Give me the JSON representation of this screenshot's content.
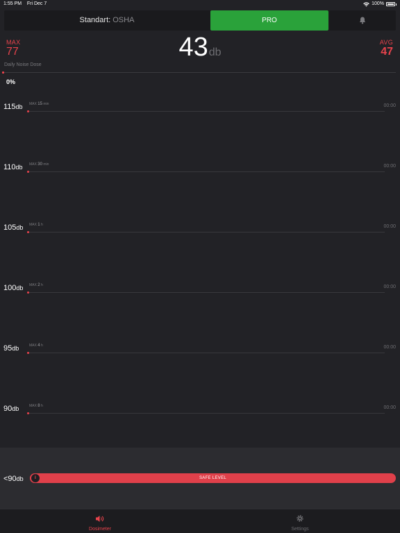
{
  "status_bar": {
    "time": "1:55 PM",
    "date": "Fri Dec 7",
    "battery": "100%"
  },
  "header": {
    "standard_label": "Standart:",
    "standard_value": "OSHA",
    "pro_label": "PRO",
    "bell_icon": "bell-icon"
  },
  "readings": {
    "max_label": "MAX",
    "max_value": "77",
    "current_value": "43",
    "current_unit": "db",
    "avg_label": "AVG",
    "avg_value": "47"
  },
  "dose": {
    "label": "Daily Noise Dose",
    "percent": "0%"
  },
  "levels": [
    {
      "db": "115",
      "unit": "db",
      "max_prefix": "MAX",
      "max_val": "15",
      "max_unit": "min",
      "time": "00:00"
    },
    {
      "db": "110",
      "unit": "db",
      "max_prefix": "MAX",
      "max_val": "30",
      "max_unit": "min",
      "time": "00:00"
    },
    {
      "db": "105",
      "unit": "db",
      "max_prefix": "MAX",
      "max_val": "1",
      "max_unit": "h",
      "time": "00:00"
    },
    {
      "db": "100",
      "unit": "db",
      "max_prefix": "MAX",
      "max_val": "2",
      "max_unit": "h",
      "time": "00:00"
    },
    {
      "db": "95",
      "unit": "db",
      "max_prefix": "MAX",
      "max_val": "4",
      "max_unit": "h",
      "time": "00:00"
    },
    {
      "db": "90",
      "unit": "db",
      "max_prefix": "MAX",
      "max_val": "8",
      "max_unit": "h",
      "time": "00:00"
    }
  ],
  "safe": {
    "level": "<90",
    "unit": "db",
    "label": "SAFE LEVEL",
    "info": "i"
  },
  "tabs": [
    {
      "label": "Dosimeter",
      "icon": "speaker-icon",
      "active": true
    },
    {
      "label": "Settings",
      "icon": "gear-icon",
      "active": false
    }
  ],
  "colors": {
    "accent_red": "#e8434c",
    "pro_green": "#2aa23a",
    "background": "#222226"
  }
}
